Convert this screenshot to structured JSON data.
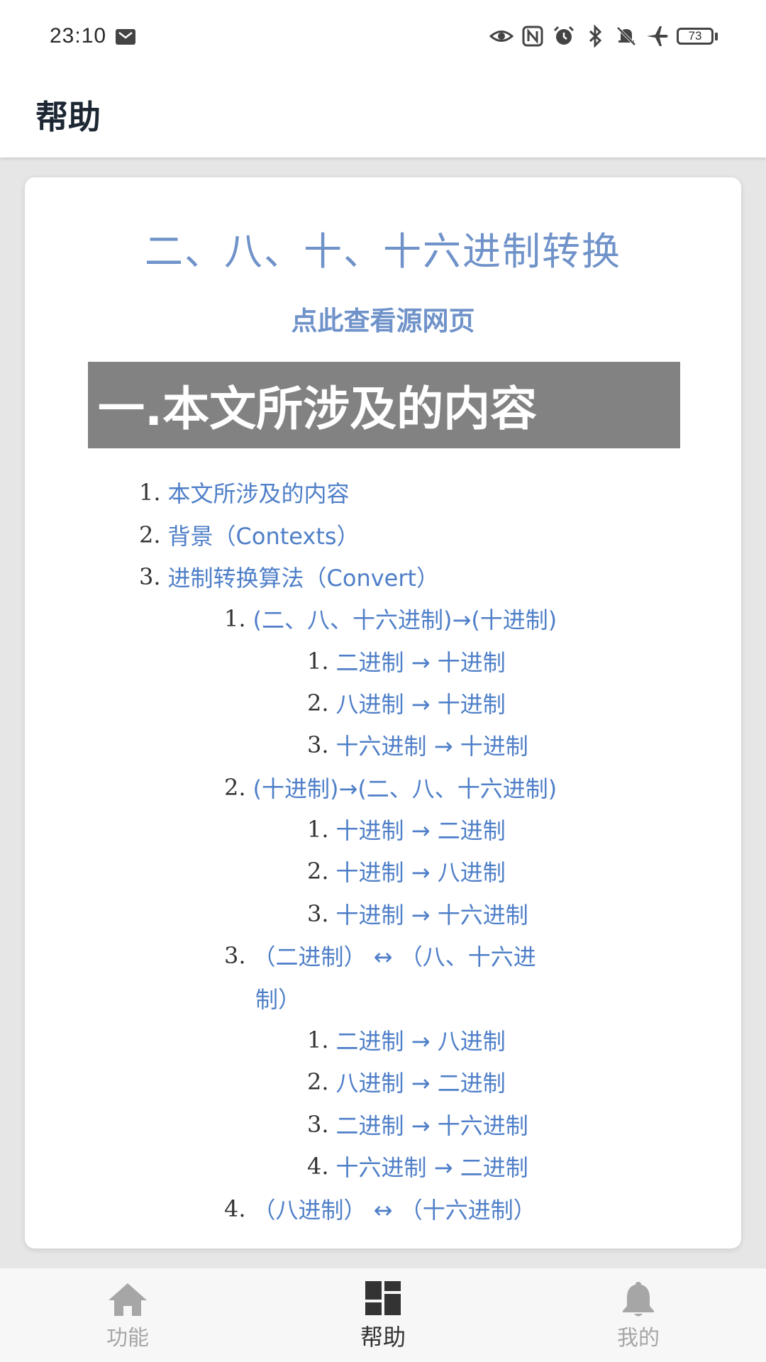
{
  "status": {
    "time": "23:10",
    "battery": "73",
    "icons": [
      "mail-icon",
      "eye-icon",
      "nfc-icon",
      "alarm-icon",
      "bluetooth-icon",
      "mute-icon",
      "airplane-icon",
      "battery-icon"
    ]
  },
  "app_bar": {
    "title": "帮助"
  },
  "doc": {
    "title": "二、八、十、十六进制转换",
    "source_link": "点此查看源网页",
    "section_heading": "一.本文所涉及的内容",
    "toc": [
      {
        "num": "1.",
        "text": "本文所涉及的内容"
      },
      {
        "num": "2.",
        "text": "背景（Contexts）"
      },
      {
        "num": "3.",
        "text": "进制转换算法（Convert）"
      },
      {
        "num": "1.",
        "text": "(二、八、十六进制)→(十进制)"
      },
      {
        "num": "1.",
        "text": "二进制 → 十进制"
      },
      {
        "num": "2.",
        "text": "八进制 → 十进制"
      },
      {
        "num": "3.",
        "text": "十六进制 → 十进制"
      },
      {
        "num": "2.",
        "text": "(十进制)→(二、八、十六进制)"
      },
      {
        "num": "1.",
        "text": "十进制 → 二进制"
      },
      {
        "num": "2.",
        "text": "十进制 → 八进制"
      },
      {
        "num": "3.",
        "text": "十进制 → 十六进制"
      },
      {
        "num": "3.",
        "text": "（二进制） ↔ （八、十六进"
      },
      {
        "num": "",
        "text": "制）"
      },
      {
        "num": "1.",
        "text": "二进制 → 八进制"
      },
      {
        "num": "2.",
        "text": "八进制 → 二进制"
      },
      {
        "num": "3.",
        "text": "二进制 → 十六进制"
      },
      {
        "num": "4.",
        "text": "十六进制 → 二进制"
      },
      {
        "num": "4.",
        "text": "（八进制） ↔ （十六进制）"
      }
    ]
  },
  "bottom_nav": {
    "items": [
      {
        "label": "功能",
        "icon": "home-icon",
        "active": false
      },
      {
        "label": "帮助",
        "icon": "dashboard-icon",
        "active": true
      },
      {
        "label": "我的",
        "icon": "bell-icon",
        "active": false
      }
    ],
    "active_color": "#333333",
    "inactive_color": "#a6a6a6"
  },
  "colors": {
    "link": "#4f7fc8",
    "title": "#6f92c9",
    "banner": "#828282"
  }
}
